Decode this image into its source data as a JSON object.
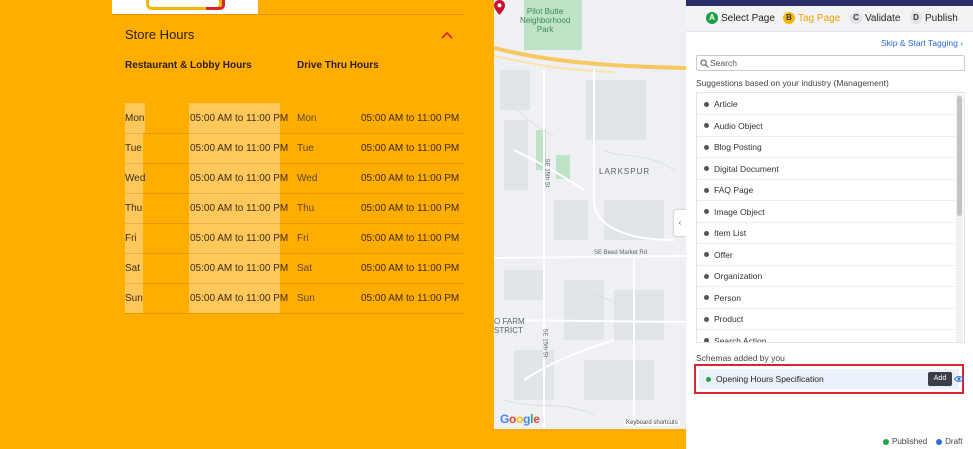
{
  "store_hours": {
    "title": "Store Hours",
    "col1_header": "Restaurant & Lobby Hours",
    "col2_header": "Drive Thru Hours",
    "rows": [
      {
        "day": "Mon",
        "lobby": "05:00 AM to 11:00 PM",
        "drive_day": "Mon",
        "drive": "05:00 AM to 11:00 PM"
      },
      {
        "day": "Tue",
        "lobby": "05:00 AM to 11:00 PM",
        "drive_day": "Tue",
        "drive": "05:00 AM to 11:00 PM"
      },
      {
        "day": "Wed",
        "lobby": "05:00 AM to 11:00 PM",
        "drive_day": "Wed",
        "drive": "05:00 AM to 11:00 PM"
      },
      {
        "day": "Thu",
        "lobby": "05:00 AM to 11:00 PM",
        "drive_day": "Thu",
        "drive": "05:00 AM to 11:00 PM"
      },
      {
        "day": "Fri",
        "lobby": "05:00 AM to 11:00 PM",
        "drive_day": "Fri",
        "drive": "05:00 AM to 11:00 PM"
      },
      {
        "day": "Sat",
        "lobby": "05:00 AM to 11:00 PM",
        "drive_day": "Sat",
        "drive": "05:00 AM to 11:00 PM"
      },
      {
        "day": "Sun",
        "lobby": "05:00 AM to 11:00 PM",
        "drive_day": "Sun",
        "drive": "05:00 AM to 11:00 PM"
      }
    ]
  },
  "map": {
    "park_label": "Pilot Butte\nNeighborhood\nPark",
    "area_label": "LARKSPUR",
    "street_1": "SE Beed Market Rd",
    "street_2": "SE 15th St",
    "street_3": "SE 15th St",
    "farm_label": "O FARM\nSTRICT",
    "google_letters": [
      "G",
      "o",
      "o",
      "g",
      "l",
      "e"
    ],
    "google_colors": [
      "#4285f4",
      "#ea4335",
      "#fbbc05",
      "#4285f4",
      "#34a853",
      "#ea4335"
    ],
    "shortcuts": "Keyboard shortcuts",
    "collapse_glyph": "‹"
  },
  "panel": {
    "steps": [
      {
        "letter": "A",
        "label": "Select Page"
      },
      {
        "letter": "B",
        "label": "Tag Page"
      },
      {
        "letter": "C",
        "label": "Validate"
      },
      {
        "letter": "D",
        "label": "Publish"
      }
    ],
    "skip_link": "Skip & Start Tagging  ›",
    "search_placeholder": "Search",
    "suggestions_header": "Suggestions based on your industry (Management)",
    "suggestions": [
      "Article",
      "Audio Object",
      "Blog Posting",
      "Digital Document",
      "FAQ Page",
      "Image Object",
      "Item List",
      "Offer",
      "Organization",
      "Person",
      "Product",
      "Search Action"
    ],
    "added_header": "Schemas added by you",
    "added_item": "Opening Hours Specification",
    "add_tooltip": "Add",
    "legend_published": "Published",
    "legend_draft": "Draft"
  }
}
